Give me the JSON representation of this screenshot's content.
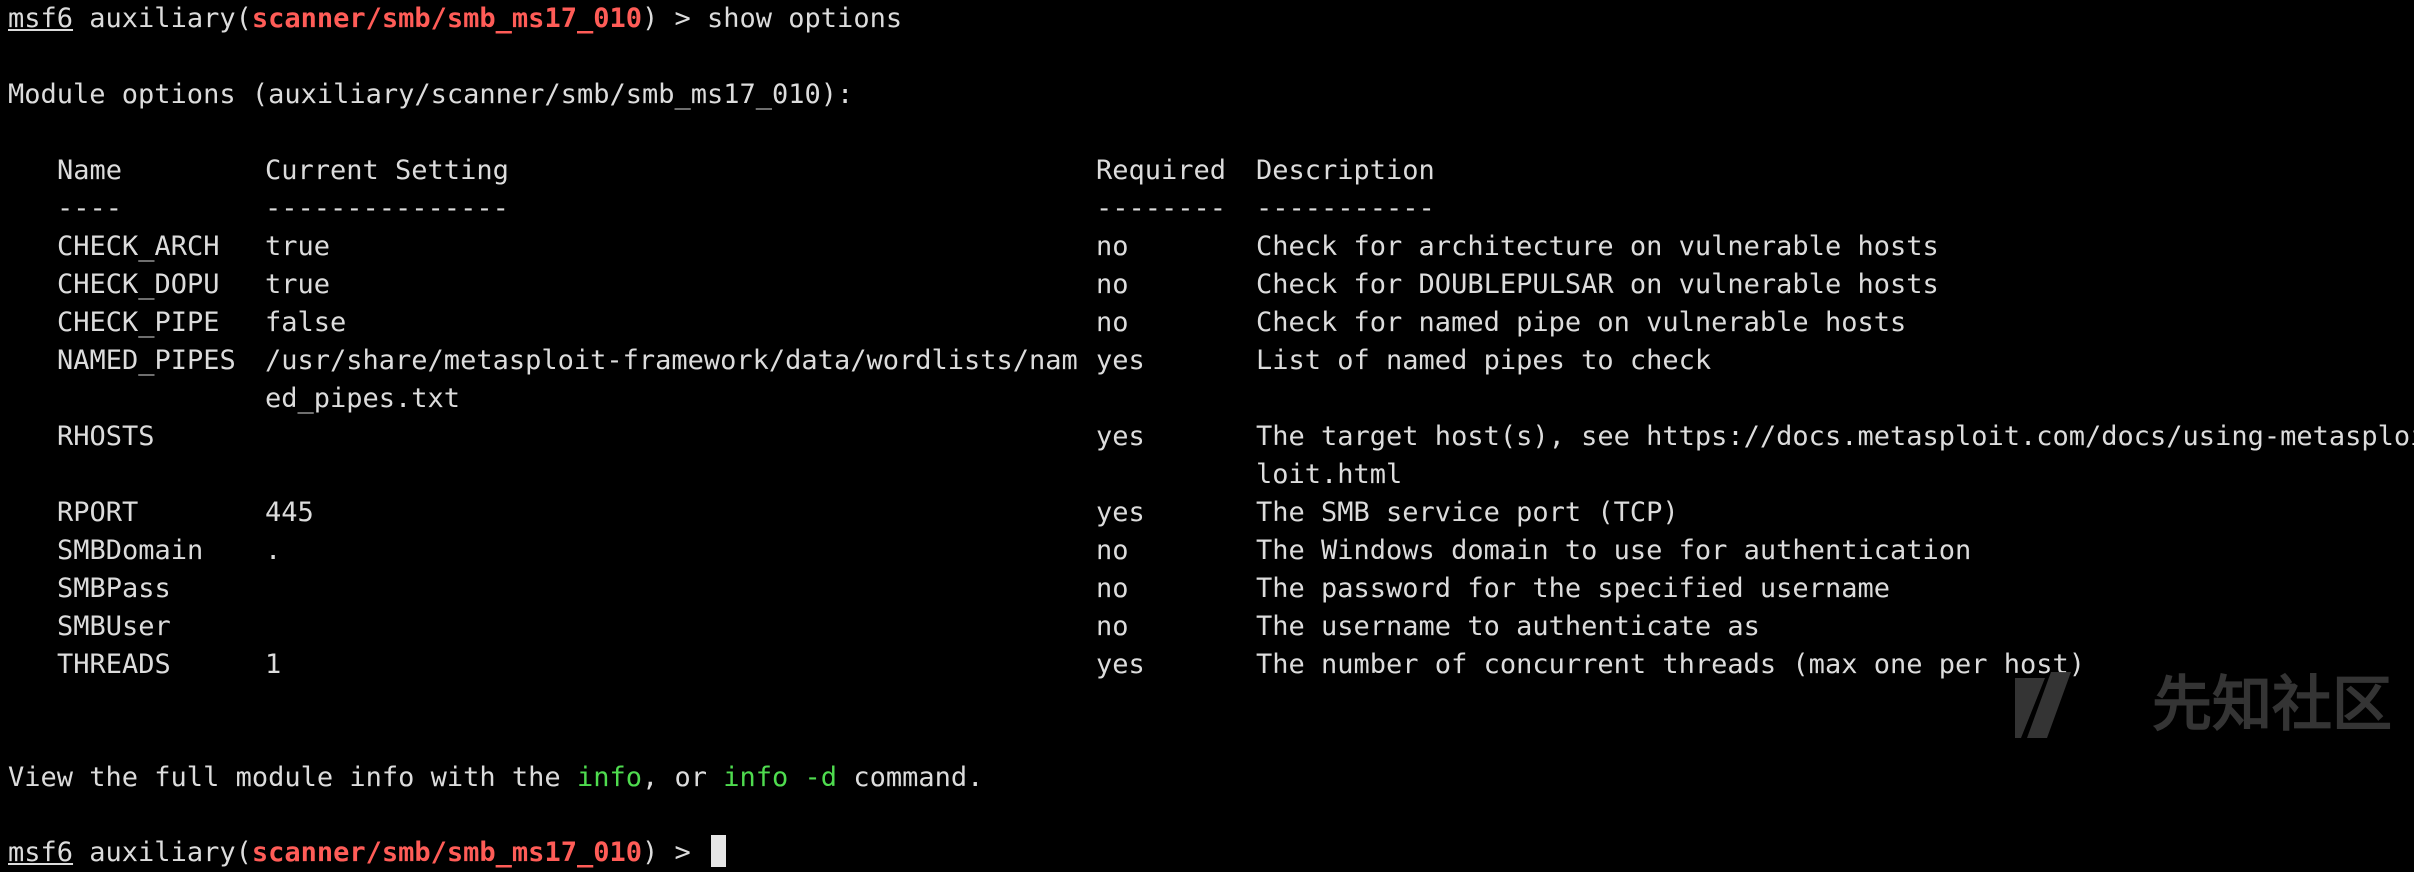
{
  "prompt": {
    "name": "msf6",
    "prefix": " auxiliary(",
    "module": "scanner/smb/smb_ms17_010",
    "suffix": ") > "
  },
  "command": "show options",
  "module_options_header": "Module options (auxiliary/scanner/smb/smb_ms17_010):",
  "table": {
    "headers": {
      "name": "Name",
      "setting": "Current Setting",
      "required": "Required",
      "description": "Description"
    },
    "dividers": {
      "name": "----",
      "setting": "---------------",
      "required": "--------",
      "description": "-----------"
    },
    "rows": [
      {
        "name": "CHECK_ARCH",
        "setting": "true",
        "required": "no",
        "description": "Check for architecture on vulnerable hosts"
      },
      {
        "name": "CHECK_DOPU",
        "setting": "true",
        "required": "no",
        "description": "Check for DOUBLEPULSAR on vulnerable hosts"
      },
      {
        "name": "CHECK_PIPE",
        "setting": "false",
        "required": "no",
        "description": "Check for named pipe on vulnerable hosts"
      },
      {
        "name": "NAMED_PIPES",
        "setting": "/usr/share/metasploit-framework/data/wordlists/nam",
        "setting_cont": "ed_pipes.txt",
        "required": "yes",
        "description": "List of named pipes to check"
      },
      {
        "name": "RHOSTS",
        "setting": "",
        "required": "yes",
        "description": "The target host(s), see https://docs.metasploit.com/docs/using-metasploi",
        "description_cont": "loit.html"
      },
      {
        "name": "RPORT",
        "setting": "445",
        "required": "yes",
        "description": "The SMB service port (TCP)"
      },
      {
        "name": "SMBDomain",
        "setting": ".",
        "required": "no",
        "description": "The Windows domain to use for authentication"
      },
      {
        "name": "SMBPass",
        "setting": "",
        "required": "no",
        "description": "The password for the specified username"
      },
      {
        "name": "SMBUser",
        "setting": "",
        "required": "no",
        "description": "The username to authenticate as"
      },
      {
        "name": "THREADS",
        "setting": "1",
        "required": "yes",
        "description": "The number of concurrent threads (max one per host)"
      }
    ]
  },
  "footer": {
    "prefix": "View the full module info with the ",
    "info": "info",
    "middle": ", or ",
    "info_d": "info -d",
    "suffix": " command."
  },
  "watermark": {
    "text": "先知社区",
    "icon": "xianzhi-logo-icon"
  },
  "colors": {
    "background": "#000000",
    "text": "#dcdcdc",
    "module": "#ff5c57",
    "highlight": "#4fdc4f"
  }
}
